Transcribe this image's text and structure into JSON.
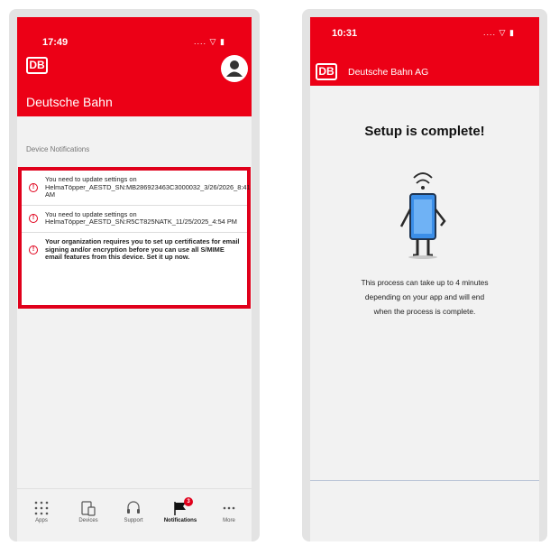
{
  "left": {
    "status": {
      "time": "17:49",
      "signal": "....",
      "wifi": "▽",
      "battery": "▮"
    },
    "header": {
      "logo": "DB",
      "title": "Deutsche Bahn"
    },
    "section_label": "Device Notifications",
    "notifications": [
      {
        "text": "You need to update settings on HelmaTöpper_AESTD_SN:MB286923463C3000032_3/26/2026_8:41 AM"
      },
      {
        "text": "You need to update settings on HelmaTöpper_AESTD_SN:R5CT825NATK_11/25/2025_4:54 PM"
      },
      {
        "text": "Your organization requires you to set up certificates for email signing and/or encryption before you can use all S/MIME email features from this device. Set it up now."
      }
    ],
    "nav": {
      "apps": "Apps",
      "devices": "Devices",
      "support": "Support",
      "notifications": "Notifications",
      "more": "More",
      "badge_count": "3"
    }
  },
  "right": {
    "status": {
      "time": "10:31",
      "signal": "....",
      "wifi": "▽",
      "battery": "▮"
    },
    "header": {
      "logo": "DB",
      "title": "Deutsche Bahn AG"
    },
    "setup_title": "Setup is complete!",
    "setup_body": [
      "This process can take up to 4 minutes",
      "depending on your app and will end",
      "when the process is complete."
    ]
  },
  "colors": {
    "brand_red": "#ec0016",
    "highlight_red": "#e0001b",
    "phone_blue": "#3b8ee8"
  }
}
